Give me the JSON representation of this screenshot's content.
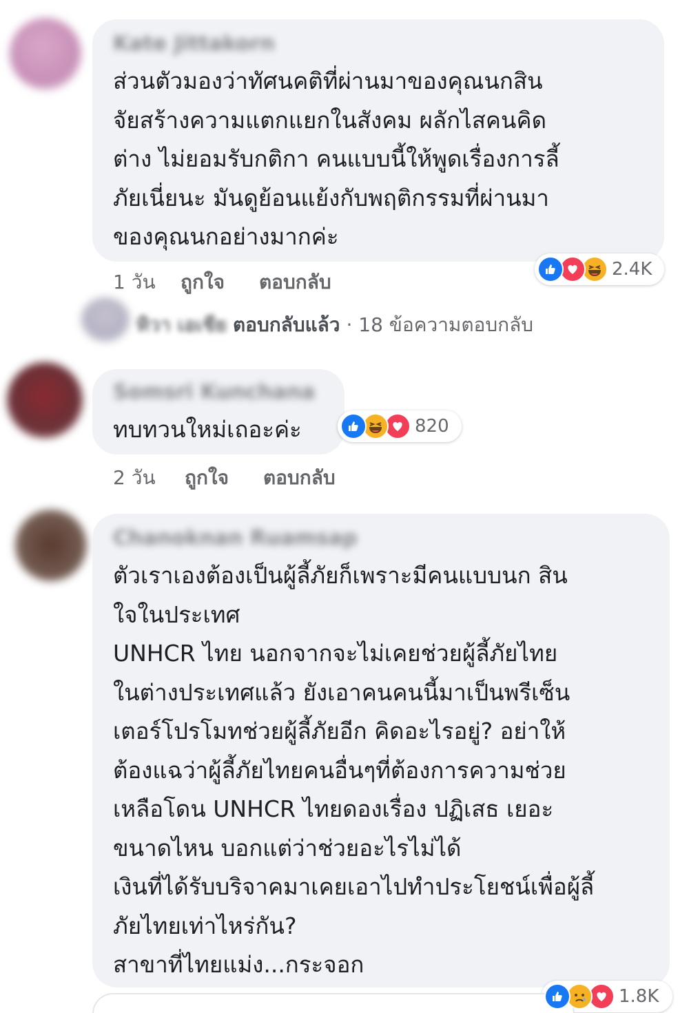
{
  "comments": [
    {
      "author": "Kate Jittakorn",
      "text": "ส่วนตัวมองว่าทัศนคติที่ผ่านมาของคุณนกสิน\nจัยสร้างความแตกแยกในสังคม ผลักไสคนคิด\nต่าง ไม่ยอมรับกติกา คนแบบนี้ให้พูดเรื่องการลี้\nภัยเนี่ยนะ มันดูย้อนแย้งกับพฤติกรรมที่ผ่านมา\nของคุณนกอย่างมากค่ะ",
      "time": "1 วัน",
      "like_label": "ถูกใจ",
      "reply_label": "ตอบกลับ",
      "reactions": [
        "like",
        "love",
        "haha"
      ],
      "reaction_count": "2.4K",
      "reply_summary": {
        "name": "ทิวา เอเชีย",
        "action": "ตอบกลับแล้ว",
        "separator": "·",
        "count_text": "18 ข้อความตอบกลับ"
      }
    },
    {
      "author": "Somsri Kunchana",
      "text": "ทบทวนใหม่เถอะค่ะ",
      "time": "2 วัน",
      "like_label": "ถูกใจ",
      "reply_label": "ตอบกลับ",
      "reactions": [
        "like",
        "haha",
        "love"
      ],
      "reaction_count": "820"
    },
    {
      "author": "Chanoknan Ruamsap",
      "text": "ตัวเราเองต้องเป็นผู้ลี้ภัยก็เพราะมีคนแบบนก สิน\nใจในประเทศ\nUNHCR ไทย นอกจากจะไม่เคยช่วยผู้ลี้ภัยไทย\nในต่างประเทศแล้ว ยังเอาคนคนนี้มาเป็นพรีเซ็น\nเตอร์โปรโมทช่วยผู้ลี้ภัยอีก คิดอะไรอยู่? อย่าให้\nต้องแฉว่าผู้ลี้ภัยไทยคนอื่นๆที่ต้องการความช่วย\nเหลือโดน UNHCR ไทยดองเรื่อง ปฏิเสธ เยอะ\nขนาดไหน บอกแต่ว่าช่วยอะไรไม่ได้\nเงินที่ได้รับบริจาคมาเคยเอาไปทำประโยชน์เพื่อผู้ลี้\nภัยไทยเท่าไหร่กัน?\nสาขาที่ไทยแม่ง...กระจอก",
      "reactions": [
        "like",
        "sad",
        "love"
      ],
      "reaction_count": "1.8K"
    }
  ],
  "colors": {
    "bubble": "#f0f2f5",
    "like": "#1877f2",
    "love": "#f33e58",
    "haha": "#f7b125",
    "secondary_text": "#65676b"
  }
}
